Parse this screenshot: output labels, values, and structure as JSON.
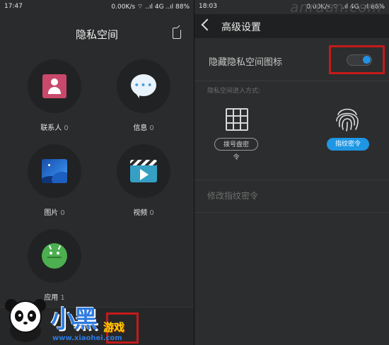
{
  "left": {
    "status": {
      "time": "17:47",
      "info": "0.00K/s ⌔ ..ıl 4G ..ıl 88%"
    },
    "title": "隐私空间",
    "apps": [
      {
        "label": "联系人",
        "count": "0",
        "icon": "contact-icon"
      },
      {
        "label": "信息",
        "count": "0",
        "icon": "message-icon"
      },
      {
        "label": "图片",
        "count": "0",
        "icon": "gallery-icon"
      },
      {
        "label": "视频",
        "count": "0",
        "icon": "video-icon"
      },
      {
        "label": "应用",
        "count": "1",
        "icon": "android-icon"
      }
    ]
  },
  "right": {
    "status": {
      "time": "18:03",
      "info": "0.00K/s ⌔ ..ıl 4G ..ıl 86%"
    },
    "title": "高级设置",
    "watermark": "anruan.com",
    "hide_icon_label": "隐藏隐私空间图标",
    "hide_icon_on": true,
    "entry_section": "隐私空间进入方式:",
    "options": [
      {
        "label": "拨号盘密令",
        "selected": false
      },
      {
        "label": "指纹密令",
        "selected": true
      }
    ],
    "change_label": "修改指纹密令"
  },
  "logo": {
    "text": "小黑",
    "sub": "游戏",
    "url": "www.xiaohei.com"
  },
  "colors": {
    "accent": "#1e96e4",
    "highlight": "#c41a1a",
    "background": "#2a2b2c"
  }
}
